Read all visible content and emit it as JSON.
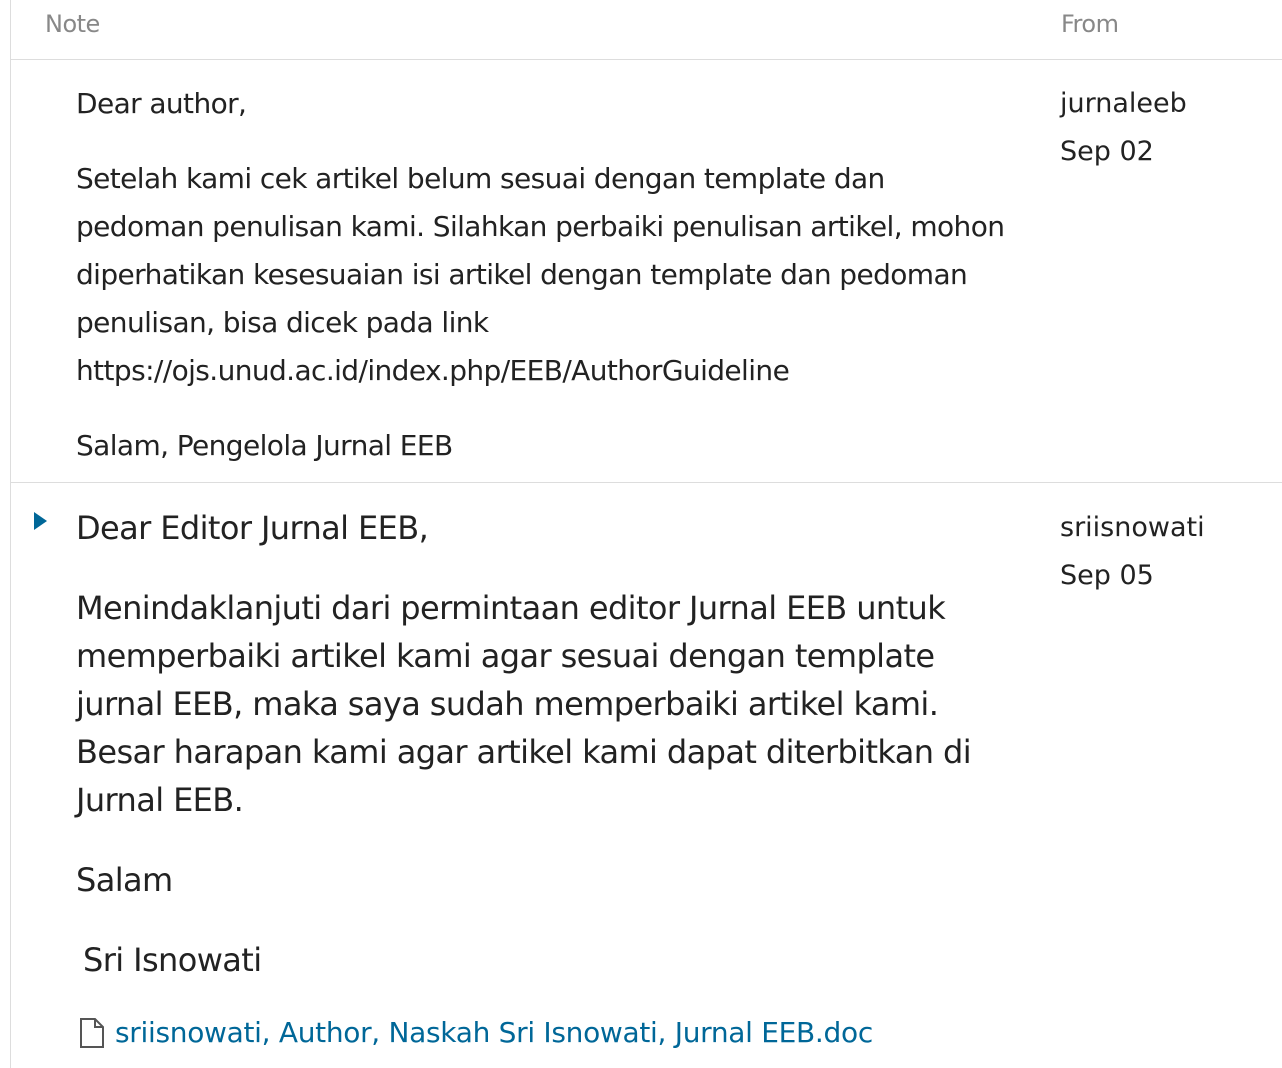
{
  "header": {
    "note_label": "Note",
    "from_label": "From"
  },
  "notes": [
    {
      "greeting": "Dear author,",
      "body": "Setelah kami cek artikel belum sesuai dengan template dan pedoman penulisan kami. Silahkan perbaiki penulisan artikel, mohon diperhatikan kesesuaian isi artikel dengan template dan pedoman penulisan, bisa dicek pada link https://ojs.unud.ac.id/index.php/EEB/AuthorGuideline",
      "closing": "Salam, Pengelola Jurnal EEB",
      "from_user": "jurnaleeb",
      "date": "Sep 02"
    },
    {
      "greeting": "Dear Editor Jurnal EEB,",
      "body": "Menindaklanjuti dari permintaan editor Jurnal EEB untuk memperbaiki artikel kami agar sesuai dengan template jurnal EEB, maka saya sudah memperbaiki artikel kami. Besar harapan kami agar artikel kami dapat diterbitkan di Jurnal EEB.",
      "closing": "Salam",
      "signature": "Sri Isnowati",
      "attachment": "sriisnowati, Author, Naskah Sri Isnowati, Jurnal EEB.doc",
      "from_user": "sriisnowati",
      "date": "Sep 05"
    }
  ],
  "icons": {
    "toggle": "triangle-right-icon",
    "file": "file-icon"
  },
  "colors": {
    "link": "#006798",
    "header_text": "#888888",
    "border": "#dddddd"
  }
}
